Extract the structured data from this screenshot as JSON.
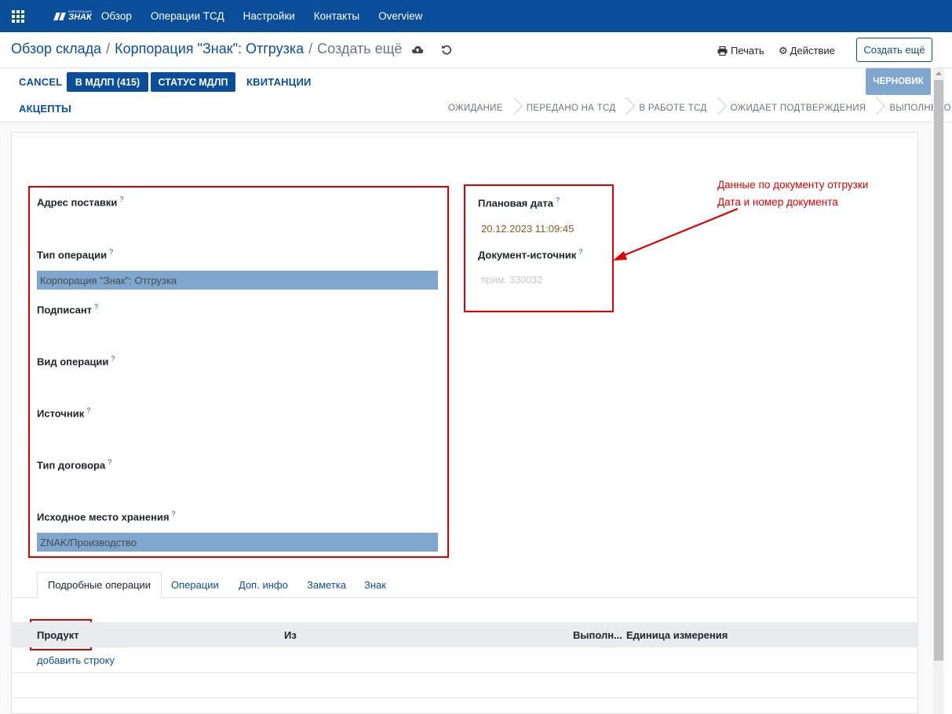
{
  "navbar": {
    "brand_small": "КОРПОРАЦИЯ",
    "brand_big": "ЗНАК",
    "menu": [
      "Обзор",
      "Операции ТСД",
      "Настройки",
      "Контакты",
      "Overview"
    ]
  },
  "breadcrumb": {
    "items": [
      "Обзор склада",
      "Корпорация \"Знак\": Отгрузка"
    ],
    "separator": "/",
    "current": "Создать ещё"
  },
  "toolbar": {
    "print_label": "Печать",
    "action_label": "Действие",
    "create_label": "Создать ещё"
  },
  "buttons": {
    "cancel": "CANCEL",
    "to_mdlp": "В МДЛП (415)",
    "status_mdlp": "СТАТУС МДЛП",
    "receipts": "КВИТАНЦИИ",
    "accepts": "АКЦЕПТЫ"
  },
  "state": {
    "badge": "ЧЕРНОВИК",
    "stages": [
      "ОЖИДАНИЕ",
      "ПЕРЕДАНО НА ТСД",
      "В РАБОТЕ ТСД",
      "ОЖИДАЕТ ПОДТВЕРЖДЕНИЯ",
      "ВЫПОЛНЕНО"
    ]
  },
  "form": {
    "help_mark": "?",
    "left": {
      "delivery_address": "Адрес поставки",
      "operation_type": "Тип операции",
      "operation_type_value": "Корпорация \"Знак\": Отгрузка",
      "signer": "Подписант",
      "operation_kind": "Вид операции",
      "source": "Источник",
      "contract_type": "Тип договора",
      "source_location": "Исходное место хранения",
      "source_location_value": "ZNAK/Производство"
    },
    "right": {
      "planned_date": "Плановая дата",
      "planned_date_value": "20.12.2023 11:09:45",
      "origin_document": "Документ-источник",
      "origin_document_placeholder": "прим. 330032"
    }
  },
  "annotation": {
    "line1": "Данные по документу отгрузки",
    "line2": "Дата и номер документа"
  },
  "tabs": [
    "Подробные операции",
    "Операции",
    "Доп. инфо",
    "Заметка",
    "Знак"
  ],
  "table": {
    "columns": [
      "Продукт",
      "Из",
      "Выполн...",
      "Единица измерения"
    ],
    "add_line": "добавить строку"
  },
  "colors": {
    "brand": "#0a4e9a",
    "highlight": "#e00000",
    "field_fill": "#7ea6cf"
  }
}
